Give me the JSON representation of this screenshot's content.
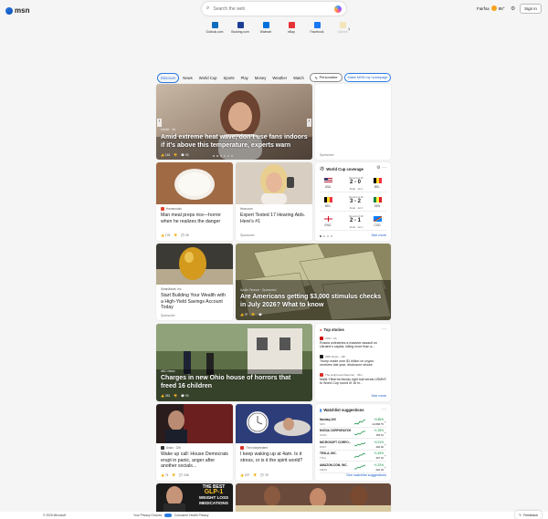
{
  "header": {
    "logo_text": "msn",
    "search_placeholder": "Search the web",
    "weather_city": "Fairfax",
    "weather_temp": "86°",
    "signin_label": "Sign in"
  },
  "quick_links": [
    {
      "label": "Outlook.com",
      "color": "#0f6cbd"
    },
    {
      "label": "Booking.com",
      "color": "#1c3f94"
    },
    {
      "label": "Walmart",
      "color": "#0071dc"
    },
    {
      "label": "eBay",
      "color": "#e53238"
    },
    {
      "label": "Facebook",
      "color": "#1877f2"
    },
    {
      "label": "Games",
      "color": "#f2c94c"
    }
  ],
  "nav": {
    "tabs": [
      "Discover",
      "News",
      "World Cup",
      "Sports",
      "Play",
      "Money",
      "Weather",
      "Watch"
    ],
    "more": "···",
    "personalize": "Personalize",
    "homepage": "Make MSN my homepage"
  },
  "hero": {
    "source": "Insider · 3d",
    "title": "Amid extreme heat wave, don’t use fans indoors if it’s above this temperature, experts warn",
    "likes": "148",
    "comments": "95"
  },
  "ad_top": {
    "label": "Sponsored"
  },
  "cards": {
    "rice": {
      "source": "Homecooks",
      "title": "Man meal preps rice—horror when he realizes the danger",
      "likes": "178",
      "comments": "28"
    },
    "hearing": {
      "source": "Hear.com",
      "title": "Expert Tested 17 Hearing Aids. Here's #1",
      "sponsored": "Sponsored"
    },
    "wealth": {
      "source": "SmartAsset, Inc.",
      "title": "Start Building Your Wealth with a High-Yield Savings Account Today",
      "sponsored": "Sponsored"
    },
    "stimulus": {
      "source": "Apollo Finance · Sponsored",
      "title": "Are Americans getting $3,000 stimulus checks in July 2026? What to know",
      "likes": "97"
    },
    "ohio": {
      "source": "ABC News",
      "title": "Charges in new Ohio house of horrors that freed 16 children",
      "likes": "283",
      "comments": "95"
    },
    "wakeup": {
      "source": "Axios · 22h",
      "title": "Wake up call: House Democrats erupt in panic, anger after another socials...",
      "likes": "74",
      "comments": "248"
    },
    "sleep": {
      "source": "The Independent",
      "title": "I keep waking up at 4am. Is it stress, or is it the spirit world?",
      "likes": "197",
      "comments": "78"
    }
  },
  "world_cup": {
    "title": "World Cup coverage",
    "matches": [
      {
        "round": "Round of 16",
        "home": "USA",
        "away": "BEL",
        "score": "2 - 0",
        "status": "Final · Jul 1"
      },
      {
        "round": "Round of 16",
        "home": "BEL",
        "away": "SEN",
        "score": "3 - 2",
        "status": "Final · Jul 1"
      },
      {
        "round": "Round of 16",
        "home": "ENG",
        "away": "COD",
        "score": "2 - 1",
        "status": "Final · Jul 1"
      }
    ],
    "see_more": "See more"
  },
  "top_stories": {
    "title": "Top stories",
    "items": [
      {
        "source": "CNN · 9h",
        "headline": "Russia unleashes a massive assault on Ukraine's capital, killing more than a...",
        "badge_color": "#cc0000"
      },
      {
        "source": "CBS News · 12h",
        "headline": "Trump made over $1 billion on crypto ventures last year, disclosure shows",
        "badge_color": "#1a1a1a"
      },
      {
        "source": "The Hollywood Reporter · 46m",
        "headline": "Malik Ytiherns bloody right bail sends USMNT to World Cup round of 16 in...",
        "badge_color": "#d93025"
      }
    ],
    "see_more": "See more"
  },
  "watchlist": {
    "title": "Watchlist suggestions",
    "rows": [
      {
        "sym": "Nasdaq 100",
        "sub": "NDX",
        "chg": "+0.85%",
        "price": "22,868.75",
        "up": true
      },
      {
        "sym": "NVIDIA CORPORATION",
        "sub": "NVDA",
        "chg": "+1.25%",
        "price": "155.51",
        "up": true
      },
      {
        "sym": "MICROSOFT CORPO...",
        "sub": "MSFT",
        "chg": "+0.21%",
        "price": "492.30",
        "up": true
      },
      {
        "sym": "TESLA, INC.",
        "sub": "TSLA",
        "chg": "+1.49%",
        "price": "307.01",
        "up": true
      },
      {
        "sym": "AMAZON.COM, INC.",
        "sub": "AMZN",
        "chg": "+1.22%",
        "price": "222.04",
        "up": true
      }
    ],
    "see_more": "See watchlist suggestions"
  },
  "bottom": {
    "glp_lines": [
      "THE BEST",
      "GLP-1",
      "WEIGHT LOSS",
      "MEDICATIONS"
    ]
  },
  "footer": {
    "copyright": "© 2026 Microsoft",
    "privacy": "Your Privacy Choices",
    "consumer": "Consumer Health Privacy",
    "feedback": "Feedback"
  }
}
